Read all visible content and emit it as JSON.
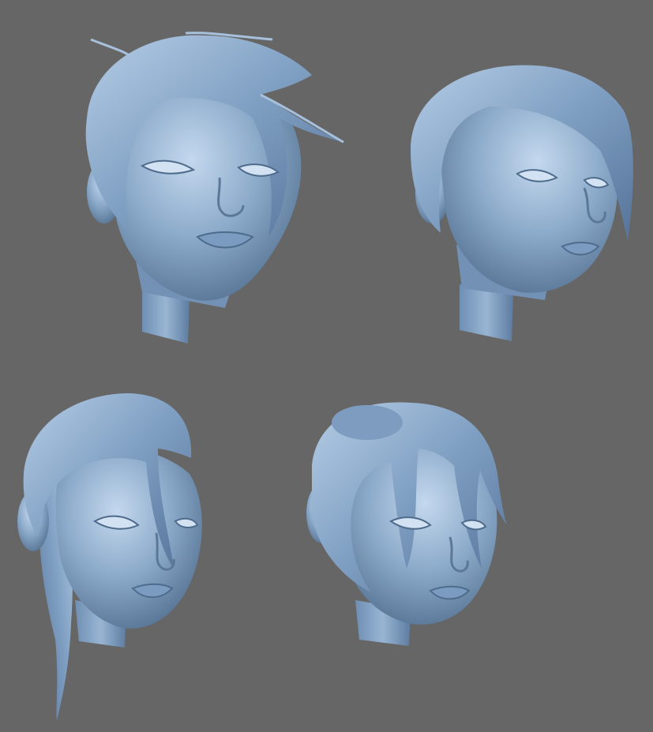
{
  "viewport": {
    "background_color": "#666666",
    "model_color": "#88a6c6",
    "model_highlight": "#c7dbef",
    "model_shadow": "#4a6687"
  },
  "models": [
    {
      "name": "head-short-tousled-hair",
      "view": "front"
    },
    {
      "name": "head-side-swept-bob",
      "view": "three-quarter"
    },
    {
      "name": "head-slicked-back-ponytail",
      "view": "three-quarter-down"
    },
    {
      "name": "head-braided-bun-bangs",
      "view": "three-quarter"
    }
  ]
}
